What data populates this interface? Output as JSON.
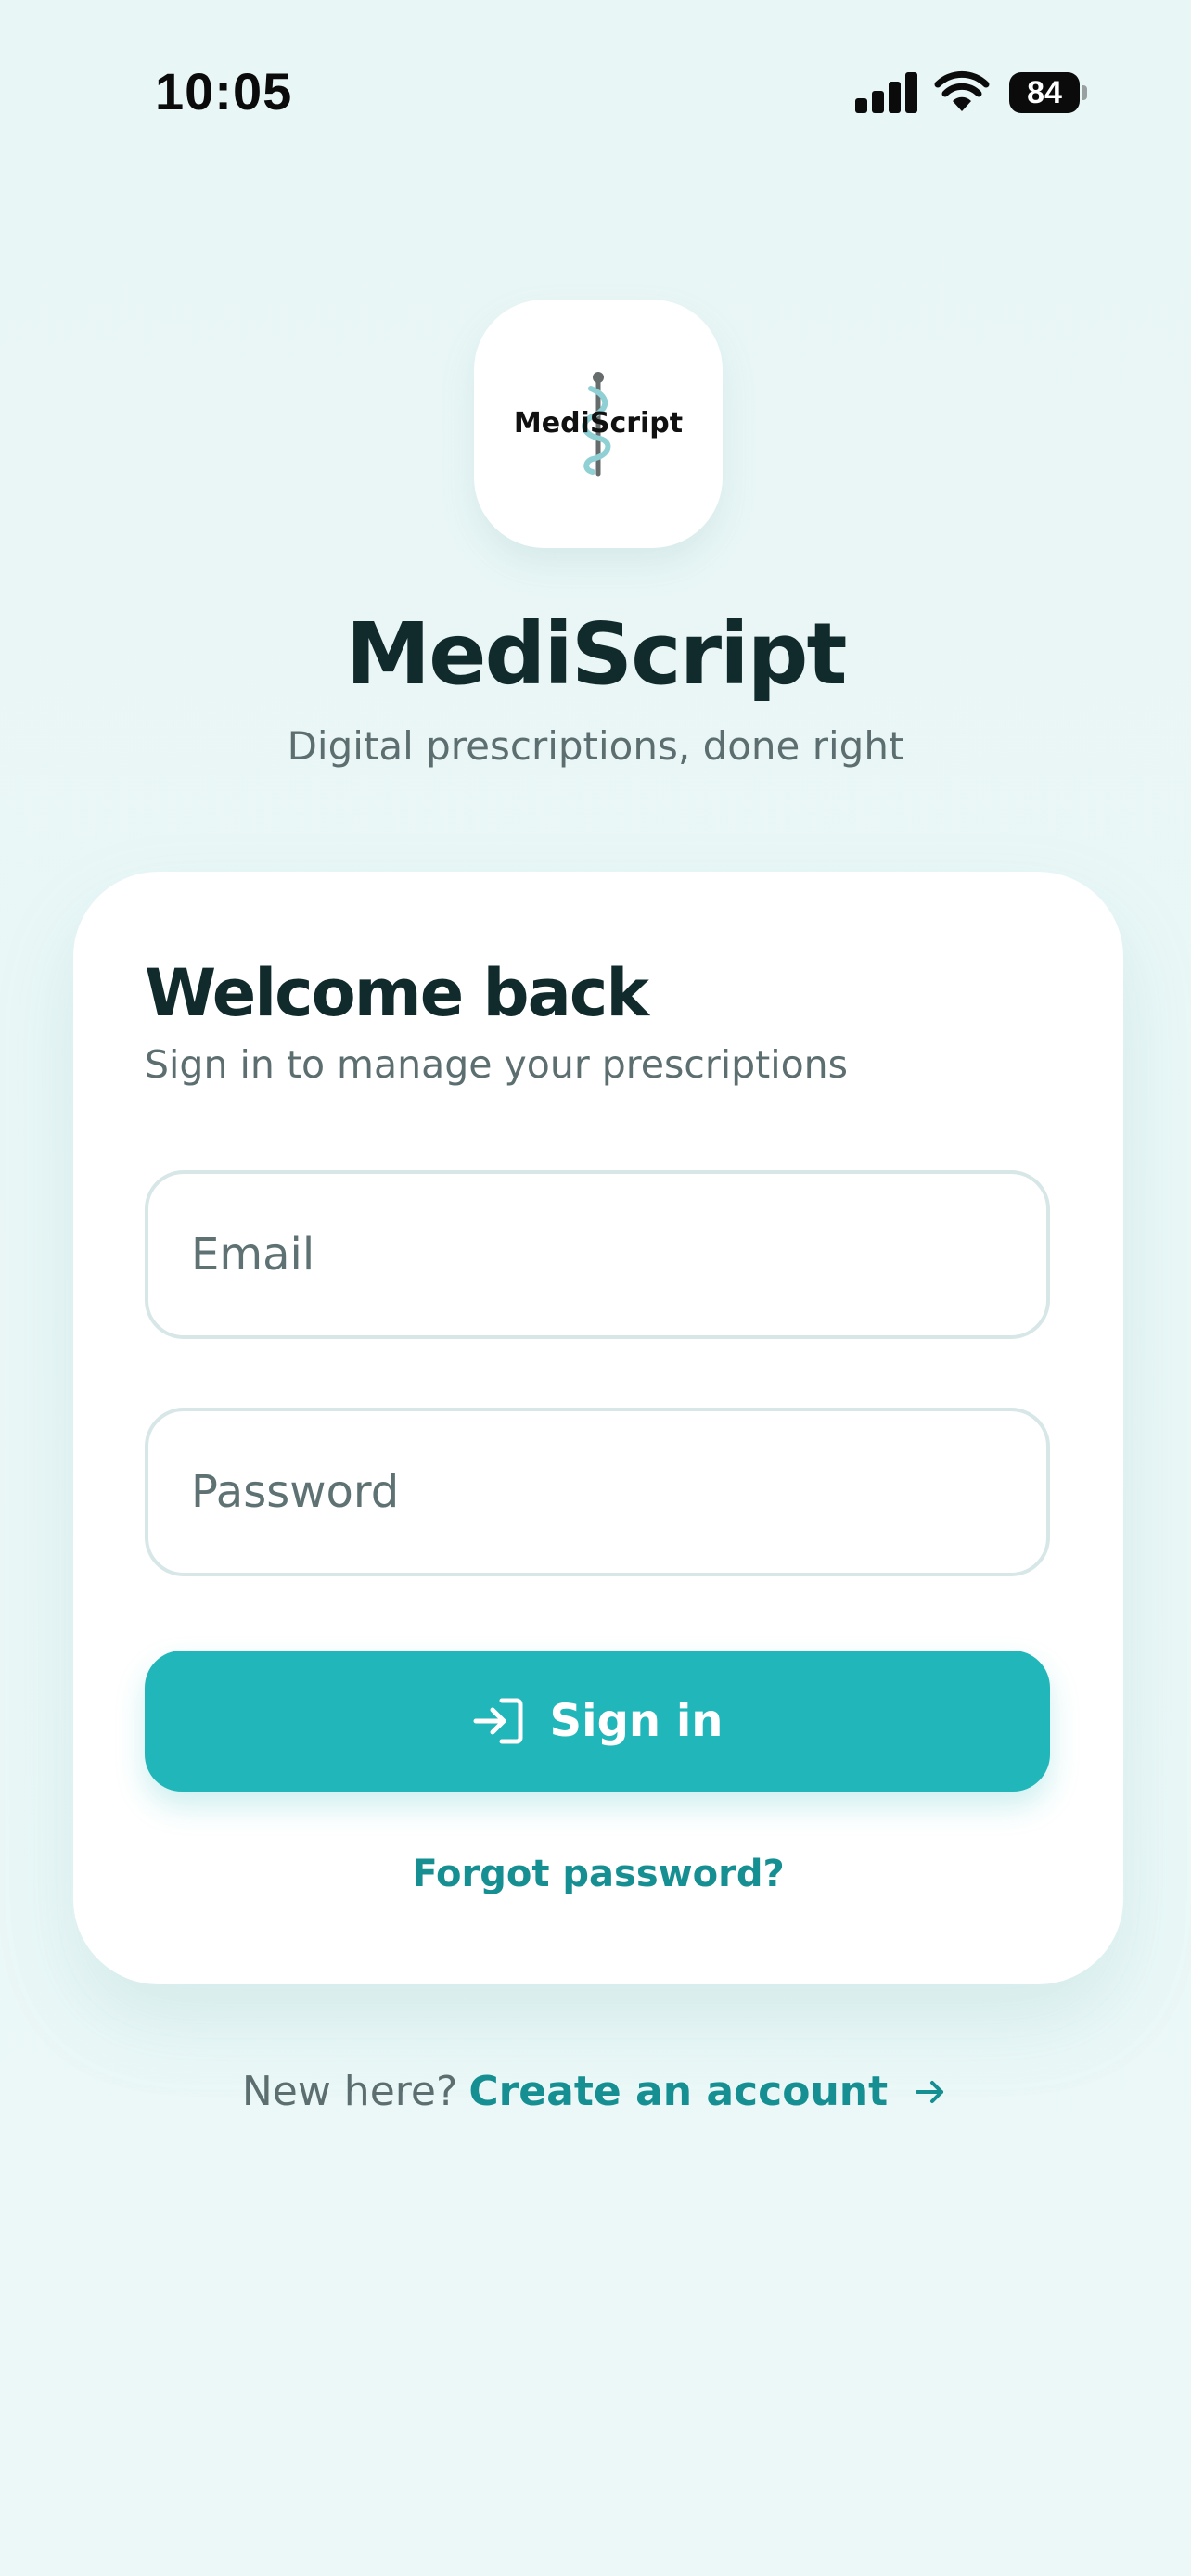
{
  "status_bar": {
    "time": "10:05",
    "battery": "84",
    "icons": [
      "signal-icon",
      "wifi-icon",
      "battery-icon"
    ]
  },
  "app": {
    "logo_text": "MediScript",
    "name": "MediScript",
    "tagline": "Digital prescriptions, done right"
  },
  "card": {
    "title": "Welcome back",
    "subtitle": "Sign in to manage your prescriptions",
    "email": {
      "placeholder": "Email",
      "value": ""
    },
    "password": {
      "placeholder": "Password",
      "value": ""
    },
    "signin_label": "Sign in",
    "forgot_label": "Forgot password?"
  },
  "footer": {
    "text": "New here?",
    "link_label": "Create an account"
  },
  "colors": {
    "accent": "#21b6b9",
    "link": "#158f92",
    "background": "#ecf8f8",
    "text_dark": "#112b2c",
    "text_muted": "#5c6e6f"
  }
}
